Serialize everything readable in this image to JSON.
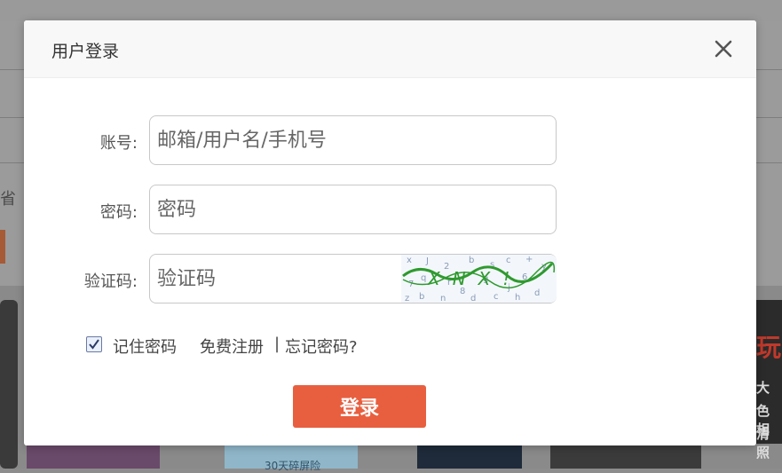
{
  "background": {
    "sidebar_text": "省",
    "tile_text": "30天碎屏险",
    "ad_big": "玩",
    "ad_lines": [
      "大",
      "色相",
      "清照"
    ]
  },
  "modal": {
    "title": "用户登录"
  },
  "form": {
    "account_label": "账号:",
    "account_placeholder": "邮箱/用户名/手机号",
    "password_label": "密码:",
    "password_placeholder": "密码",
    "captcha_label": "验证码:",
    "captcha_placeholder": "验证码",
    "captcha_text": "XNX!"
  },
  "options": {
    "remember_label": "记住密码",
    "remember_checked": true,
    "register_link": "免费注册",
    "separator": "|",
    "forgot_link": "忘记密码?"
  },
  "actions": {
    "login_label": "登录"
  },
  "colors": {
    "accent": "#e85f3f",
    "captcha_green": "#2f9a2f"
  }
}
